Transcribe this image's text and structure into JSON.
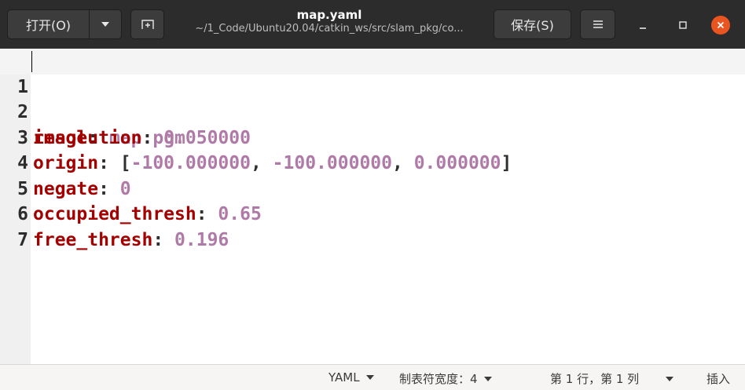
{
  "header": {
    "open_label": "打开(O)",
    "title": "map.yaml",
    "subtitle": "~/1_Code/Ubuntu20.04/catkin_ws/src/slam_pkg/co...",
    "save_label": "保存(S)",
    "menu_icon": "hamburger-icon",
    "new_tab_icon": "new-tab-icon",
    "close_color": "#e95420"
  },
  "editor": {
    "lines": [
      {
        "num": "1",
        "key": "image",
        "value": "map.pgm"
      },
      {
        "num": "2",
        "key": "resolution",
        "value": "0.050000"
      },
      {
        "num": "3",
        "key": "origin",
        "v1": "-100.000000",
        "v2": "-100.000000",
        "v3": "0.000000"
      },
      {
        "num": "4",
        "key": "negate",
        "value": "0"
      },
      {
        "num": "5",
        "key": "occupied_thresh",
        "value": "0.65"
      },
      {
        "num": "6",
        "key": "free_thresh",
        "value": "0.196"
      },
      {
        "num": "7"
      }
    ],
    "colors": {
      "key": "#a40000",
      "value": "#b07aa8"
    }
  },
  "status": {
    "language": "YAML",
    "tab_width": "制表符宽度：4",
    "position": "第 1 行，第 1 列",
    "mode": "插入"
  }
}
